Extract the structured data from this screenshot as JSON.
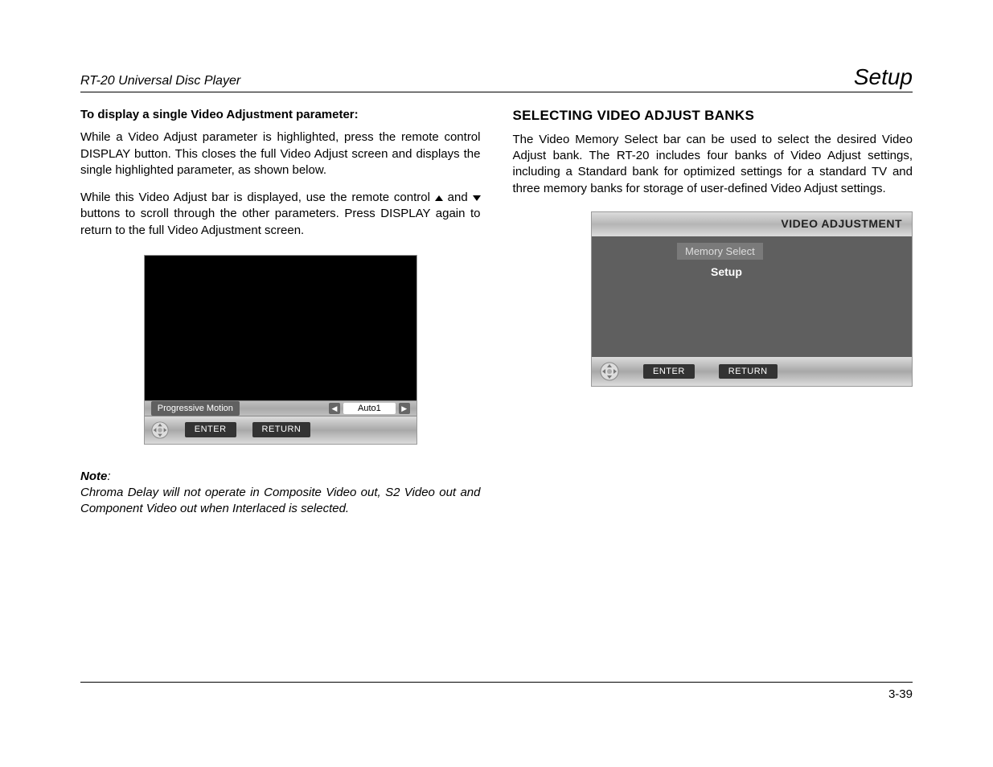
{
  "header": {
    "left": "RT-20 Universal Disc Player",
    "right": "Setup"
  },
  "left_col": {
    "subhead": "To display a single Video Adjustment parameter:",
    "p1": "While a Video Adjust parameter is highlighted, press the remote control DISPLAY button. This closes the full Video Adjust screen and displays the single highlighted parameter, as shown below.",
    "p2a": "While this Video Adjust bar is displayed, use the remote control",
    "p2b": " and ",
    "p2c": " buttons to scroll through the other parameters. Press DISPLAY again to return to the full Video Adjustment screen.",
    "param_label": "Progressive Motion",
    "param_value": "Auto1",
    "enter": "ENTER",
    "return": "RETURN",
    "note_label": "Note",
    "note_colon": ":",
    "note_body": "Chroma Delay will not operate in Composite Video out, S2 Video out and Component Video out when Interlaced is selected."
  },
  "right_col": {
    "heading": "SELECTING VIDEO ADJUST BANKS",
    "p1": "The Video Memory Select bar can be used to select the desired Video Adjust bank. The RT-20 includes four banks of Video Adjust settings, including a Standard bank for optimized settings for a standard TV and three memory banks for storage of user-defined Video Adjust settings.",
    "s2_title": "VIDEO ADJUSTMENT",
    "s2_mem": "Memory Select",
    "s2_setup": "Setup",
    "enter": "ENTER",
    "return": "RETURN"
  },
  "footer": {
    "page": "3-39"
  }
}
